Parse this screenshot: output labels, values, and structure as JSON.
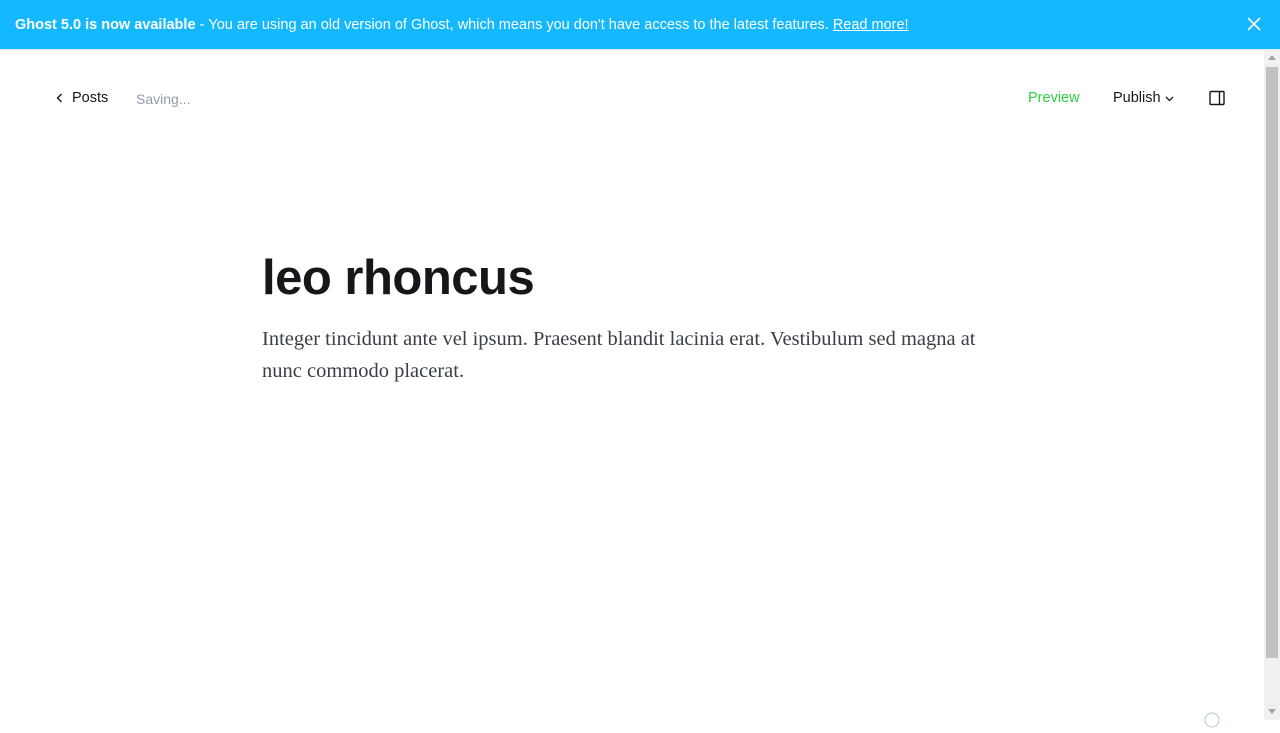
{
  "banner": {
    "headline": "Ghost 5.0 is now available",
    "separator": "-",
    "message": "You are using an old version of Ghost, which means you don't have access to the latest features.",
    "link_text": "Read more!",
    "close_icon": "close-icon",
    "background_color": "#14b8ff"
  },
  "header": {
    "back_label": "Posts",
    "back_icon": "chevron-left-icon",
    "status": "Saving...",
    "preview_label": "Preview",
    "publish_label": "Publish",
    "publish_icon": "chevron-down-icon",
    "settings_icon": "sidebar-toggle-icon",
    "accent_color": "#30cf43"
  },
  "post": {
    "title": "leo rhoncus",
    "body": "Integer tincidunt ante vel ipsum. Praesent blandit lacinia erat. Vestibulum sed magna at nunc commodo placerat."
  },
  "footer": {
    "word_count": "",
    "help_icon": "help-icon"
  }
}
